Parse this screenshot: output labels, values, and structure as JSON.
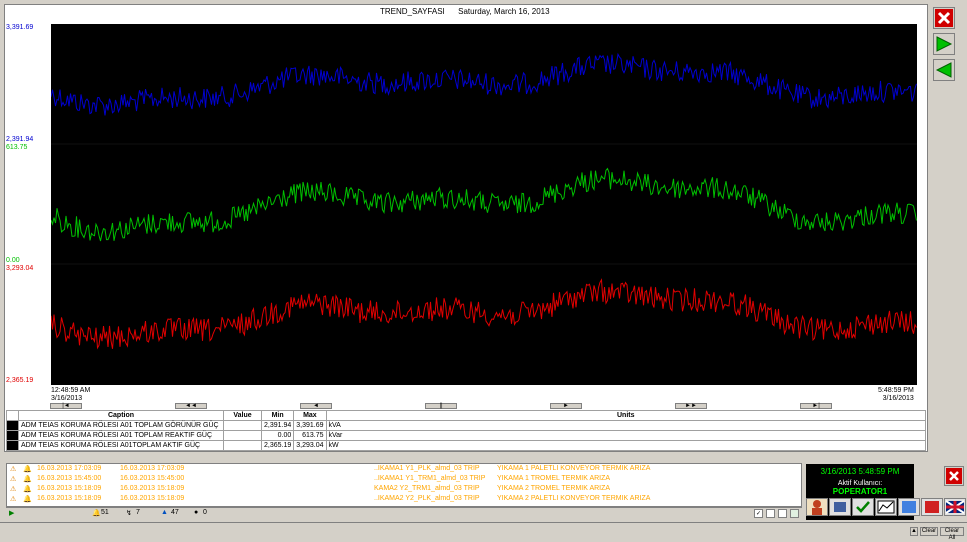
{
  "header": {
    "title": "TREND_SAYFASI",
    "date": "Saturday, March 16, 2013"
  },
  "axis": {
    "blue_max": "3,391.69",
    "blue_min": "2,391.94",
    "green_max": "613.75",
    "green_min": "0.00",
    "red_max": "3,293.04",
    "red_min": "2,365.19",
    "start_time": "12:48:59 AM",
    "start_date": "3/16/2013",
    "end_time": "5:48:59 PM",
    "end_date": "3/16/2013"
  },
  "colors": {
    "blue": "#0000d0",
    "green": "#00c000",
    "red": "#e00000"
  },
  "nav": [
    "|◄",
    "◄◄",
    "◄",
    "||",
    "►",
    "►►",
    "►|"
  ],
  "legend": {
    "headers": [
      "Caption",
      "Value",
      "Min",
      "Max",
      "Units"
    ],
    "rows": [
      {
        "caption": "ADM TEIAS KORUMA RÖLESI A01 TOPLAM GÖRÜNÜR GÜÇ",
        "value": "",
        "min": "2,391.94",
        "max": "3,391.69",
        "unit": "kVA"
      },
      {
        "caption": "ADM TEIAS KORUMA RÖLESI A01 TOPLAM REAKTIF GÜÇ",
        "value": "",
        "min": "0.00",
        "max": "613.75",
        "unit": "kVar"
      },
      {
        "caption": "ADM TEIAS KORUMA RÖLESI A01TOPLAM AKTIF GÜÇ",
        "value": "",
        "min": "2,365.19",
        "max": "3,293.04",
        "unit": "kW"
      }
    ]
  },
  "alarms": [
    {
      "t1": "16.03.2013 17:03:09",
      "t2": "16.03.2013 17:03:09",
      "tag": "..IKAMA1 Y1_PLK_almd_03 TRIP",
      "desc": "YIKAMA 1 PALETLI KONVEYOR TERMIK ARIZA"
    },
    {
      "t1": "16.03.2013 15:45:00",
      "t2": "16.03.2013 15:45:00",
      "tag": "..IKAMA1 Y1_TRM1_almd_03 TRIP",
      "desc": "YIKAMA 1 TROMEL TERMIK ARIZA"
    },
    {
      "t1": "16.03.2013 15:18:09",
      "t2": "16.03.2013 15:18:09",
      "tag": "KAMA2 Y2_TRM1_almd_03 TRIP",
      "desc": "YIKAMA 2 TROMEL TERMIK ARIZA"
    },
    {
      "t1": "16.03.2013 15:18:09",
      "t2": "16.03.2013 15:18:09",
      "tag": "..IKAMA2 Y2_PLK_almd_03 TRIP",
      "desc": "YIKAMA 2 PALETLI KONVEYOR TERMIK ARIZA"
    }
  ],
  "alarm_status": {
    "count1": "51",
    "count2": "7",
    "count3": "47",
    "count4": "0"
  },
  "user": {
    "datetime": "3/16/2013 5:48:59 PM",
    "label": "Aktif Kullanıcı:",
    "name": "POPERATOR1"
  },
  "footer": {
    "clear": "Clear",
    "clear_all": "Clear All"
  }
}
